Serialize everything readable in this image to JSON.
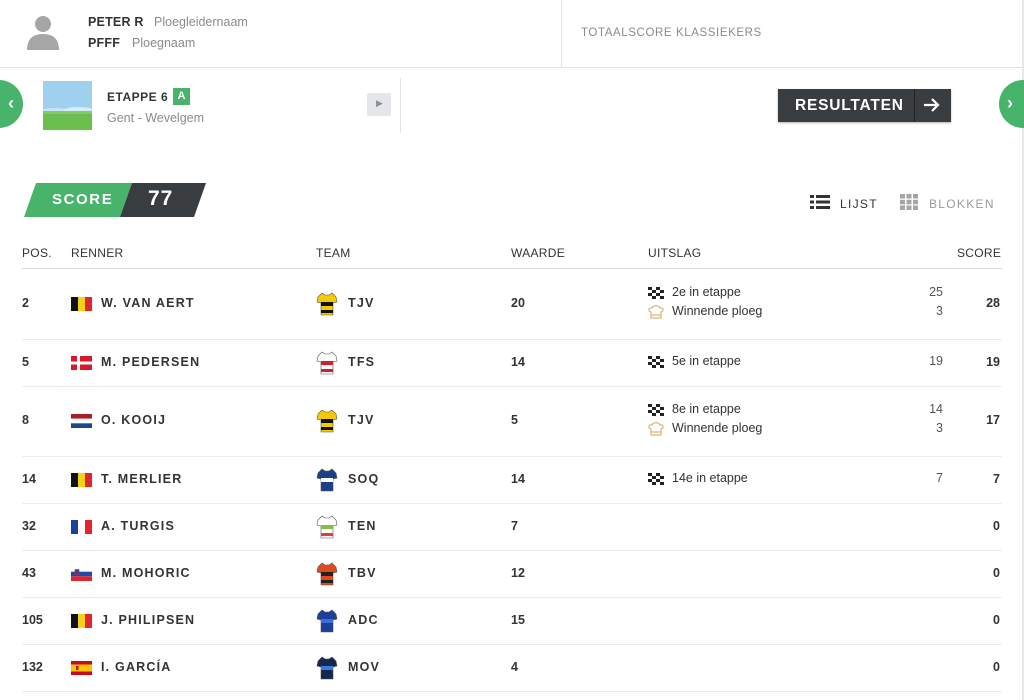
{
  "user": {
    "name": "PETER R",
    "name_label": "Ploegleidernaam",
    "team": "PFFF",
    "team_label": "Ploegnaam"
  },
  "header": {
    "total_score_label": "TOTAALSCORE KLASSIEKERS"
  },
  "stage": {
    "title": "ETAPPE 6",
    "badge": "A",
    "route": "Gent - Wevelgem"
  },
  "results_button": {
    "label": "RESULTATEN"
  },
  "score": {
    "label": "SCORE",
    "value": "77"
  },
  "views": {
    "list_label": "LIJST",
    "blocks_label": "BLOKKEN",
    "active": "list"
  },
  "colors": {
    "accent": "#48b36b",
    "dark": "#3a3d3f"
  },
  "table": {
    "headers": {
      "pos": "POS.",
      "rider": "RENNER",
      "team": "TEAM",
      "value": "WAARDE",
      "result": "UITSLAG",
      "score": "SCORE"
    },
    "rows": [
      {
        "pos": "2",
        "flag": "be",
        "rider": "W. VAN AERT",
        "jersey": "tjv",
        "team": "TJV",
        "value": "20",
        "results": [
          {
            "icon": "checkered-flag",
            "text": "2e in etappe",
            "points": "25"
          },
          {
            "icon": "chef-hat",
            "text": "Winnende ploeg",
            "points": "3"
          }
        ],
        "score": "28"
      },
      {
        "pos": "5",
        "flag": "dk",
        "rider": "M. PEDERSEN",
        "jersey": "tfs",
        "team": "TFS",
        "value": "14",
        "results": [
          {
            "icon": "checkered-flag",
            "text": "5e in etappe",
            "points": "19"
          }
        ],
        "score": "19"
      },
      {
        "pos": "8",
        "flag": "nl",
        "rider": "O. KOOIJ",
        "jersey": "tjv",
        "team": "TJV",
        "value": "5",
        "results": [
          {
            "icon": "checkered-flag",
            "text": "8e in etappe",
            "points": "14"
          },
          {
            "icon": "chef-hat",
            "text": "Winnende ploeg",
            "points": "3"
          }
        ],
        "score": "17"
      },
      {
        "pos": "14",
        "flag": "be",
        "rider": "T. MERLIER",
        "jersey": "soq",
        "team": "SOQ",
        "value": "14",
        "results": [
          {
            "icon": "checkered-flag",
            "text": "14e in etappe",
            "points": "7"
          }
        ],
        "score": "7"
      },
      {
        "pos": "32",
        "flag": "fr",
        "rider": "A. TURGIS",
        "jersey": "ten",
        "team": "TEN",
        "value": "7",
        "results": [],
        "score": "0"
      },
      {
        "pos": "43",
        "flag": "si",
        "rider": "M. MOHORIC",
        "jersey": "tbv",
        "team": "TBV",
        "value": "12",
        "results": [],
        "score": "0"
      },
      {
        "pos": "105",
        "flag": "be",
        "rider": "J. PHILIPSEN",
        "jersey": "adc",
        "team": "ADC",
        "value": "15",
        "results": [],
        "score": "0"
      },
      {
        "pos": "132",
        "flag": "es",
        "rider": "I. GARCÍA",
        "jersey": "mov",
        "team": "MOV",
        "value": "4",
        "results": [],
        "score": "0"
      }
    ]
  }
}
